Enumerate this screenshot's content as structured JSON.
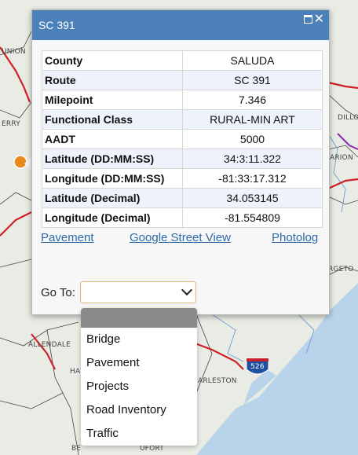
{
  "map": {
    "labels": [
      "UNION",
      "ERRY",
      "ARION",
      "DILLO",
      "RGETO",
      "ALLENDALE",
      "HA",
      "ARLESTON",
      "BE",
      "UFORT",
      "526"
    ]
  },
  "popup": {
    "title": "SC 391",
    "rows": [
      {
        "key": "County",
        "value": "SALUDA"
      },
      {
        "key": "Route",
        "value": "SC 391"
      },
      {
        "key": "Milepoint",
        "value": "7.346"
      },
      {
        "key": "Functional Class",
        "value": "RURAL-MIN ART"
      },
      {
        "key": "AADT",
        "value": "5000"
      },
      {
        "key": "Latitude (DD:MM:SS)",
        "value": "34:3:11.322"
      },
      {
        "key": "Longitude (DD:MM:SS)",
        "value": "-81:33:17.312"
      },
      {
        "key": "Latitude (Decimal)",
        "value": "34.053145"
      },
      {
        "key": "Longitude (Decimal)",
        "value": "-81.554809"
      }
    ],
    "links": {
      "pavement": "Pavement",
      "street_view": "Google Street View",
      "photolog": "Photolog"
    },
    "goto_label": "Go To:"
  },
  "dropdown": {
    "options": [
      "Bridge",
      "Pavement",
      "Projects",
      "Road Inventory",
      "Traffic"
    ]
  },
  "colors": {
    "header": "#4b80b8",
    "link": "#2d6aa8",
    "marker": "#e8891e",
    "road": "#d0202a"
  }
}
